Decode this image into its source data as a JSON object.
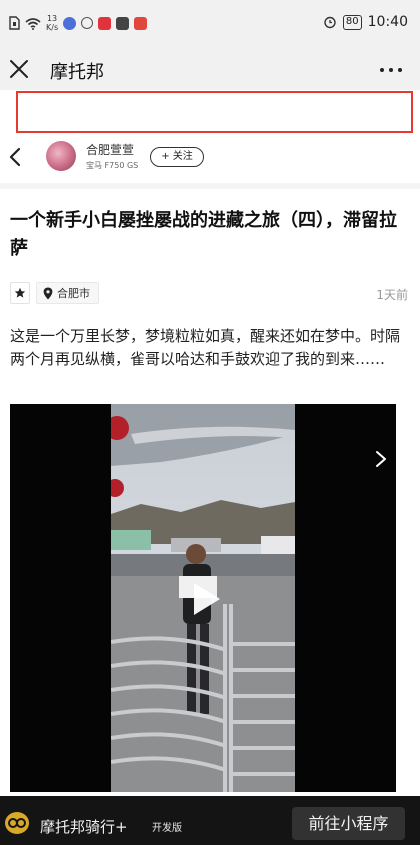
{
  "status_bar": {
    "network_speed_value": "13",
    "network_speed_unit": "K/s",
    "battery": "80",
    "time": "10:40",
    "icons": [
      "sim-icon",
      "wifi-icon",
      "notification-app-icons",
      "alarm-icon",
      "battery-icon"
    ]
  },
  "title_bar": {
    "title": "摩托邦",
    "close_icon": "close-icon",
    "more_icon": "more-icon"
  },
  "author": {
    "name": "合肥萱萱",
    "bike": "宝马 F750 GS",
    "follow_label": "+ 关注"
  },
  "article": {
    "title": "一个新手小白屡挫屡战的进藏之旅（四），滞留拉萨",
    "location": "合肥市",
    "date": "1天前",
    "body": "这是一个万里长梦，梦境粒粒如真，醒来还如在梦中。时隔两个月再见纵横，雀哥以哈达和手鼓欢迎了我的到来……"
  },
  "mini_program_bar": {
    "name": "摩托邦骑行+",
    "tag": "开发版",
    "button_label": "前往小程序"
  },
  "colors": {
    "accent_red": "#e53a2e",
    "status_bg": "#f1f1f1",
    "bottom_bar_bg": "#141414",
    "logo_gold": "#d8a829"
  }
}
